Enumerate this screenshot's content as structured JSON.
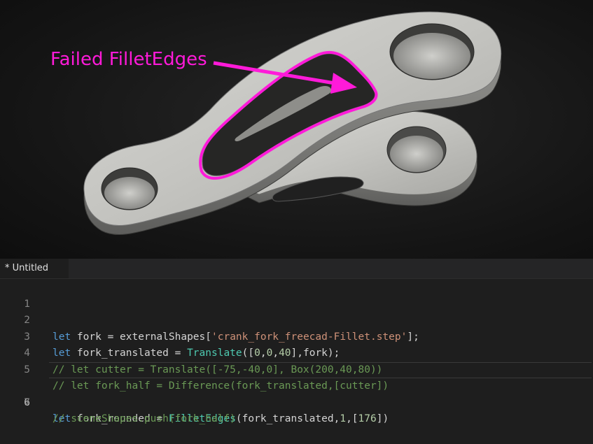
{
  "viewport": {
    "annotation": "Failed FilletEdges",
    "accent_color": "#ff1ad9"
  },
  "editor": {
    "tab_label": "* Untitled",
    "lines": [
      {
        "number": "1",
        "text": ""
      },
      {
        "number": "2",
        "text": "let fork = externalShapes['crank_fork_freecad-Fillet.step'];"
      },
      {
        "number": "3",
        "text": "let fork_translated = Translate([0,0,40],fork);"
      },
      {
        "number": "4",
        "text": "// let cutter = Translate([-75,-40,0], Box(200,40,80))"
      },
      {
        "number": "5",
        "text": "// let fork_half = Difference(fork_translated,[cutter])"
      },
      {
        "number": "6",
        "text": "let fork_rounded = FilletEdges(fork_translated,1,[176])"
      },
      {
        "number": "7",
        "text": "// sceneShapes.push(fork_half)"
      }
    ]
  }
}
